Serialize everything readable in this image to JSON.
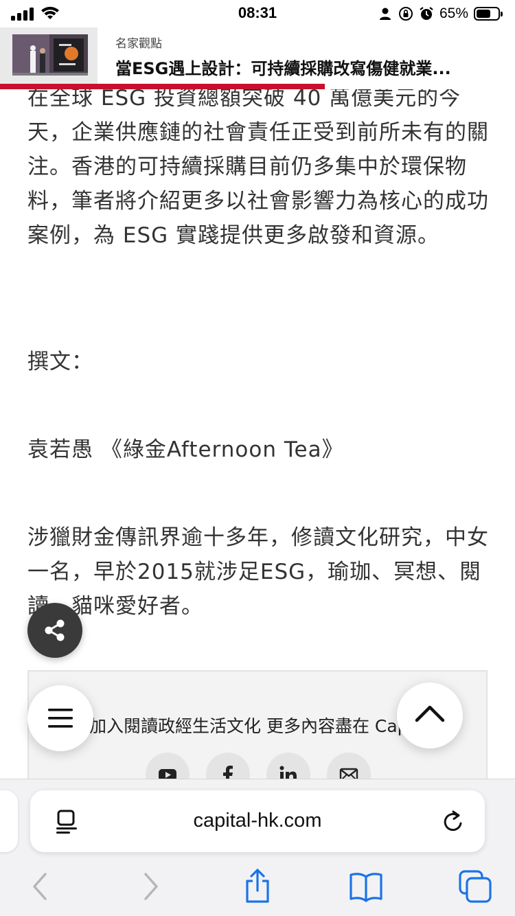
{
  "status_bar": {
    "time": "08:31",
    "battery_percent": "65%",
    "battery_level": 0.65,
    "icons": [
      "cellular-signal-icon",
      "wifi-icon",
      "person-icon",
      "orientation-lock-icon",
      "alarm-icon",
      "battery-icon"
    ]
  },
  "article_header": {
    "category": "名家觀點",
    "title": "當ESG遇上設計：可持續採購改寫傷健就業...",
    "read_progress": 0.63,
    "progress_color": "#c8102e"
  },
  "article": {
    "paragraph_1": "在全球 ESG 投資總額突破 40 萬億美元的今天，企業供應鏈的社會責任正受到前所未有的關注。香港的可持續採購目前仍多集中於環保物料，筆者將介紹更多以社會影響力為核心的成功案例，為 ESG 實踐提供更多啟發和資源。",
    "author_label": "撰文：",
    "author_line": "袁若愚 《綠金Afternoon Tea》",
    "author_bio": "涉獵財金傳訊界逾十多年，修讀文化研究，中女一名，早於2015就涉足ESG，瑜珈、冥想、閱讀、貓咪愛好者。"
  },
  "share_card": {
    "text": "加入閱讀政經生活文化 更多內容盡在 Capital",
    "social_icons": [
      "youtube-icon",
      "facebook-icon",
      "linkedin-icon",
      "email-icon"
    ]
  },
  "floating_buttons": {
    "share": "share-icon",
    "menu": "hamburger-menu-icon",
    "back_to_top": "chevron-up-icon"
  },
  "browser": {
    "url": "capital-hk.com",
    "toolbar": [
      "back-icon",
      "forward-icon",
      "share-icon",
      "bookmarks-icon",
      "tabs-icon"
    ],
    "accent_color": "#1a73e8"
  }
}
